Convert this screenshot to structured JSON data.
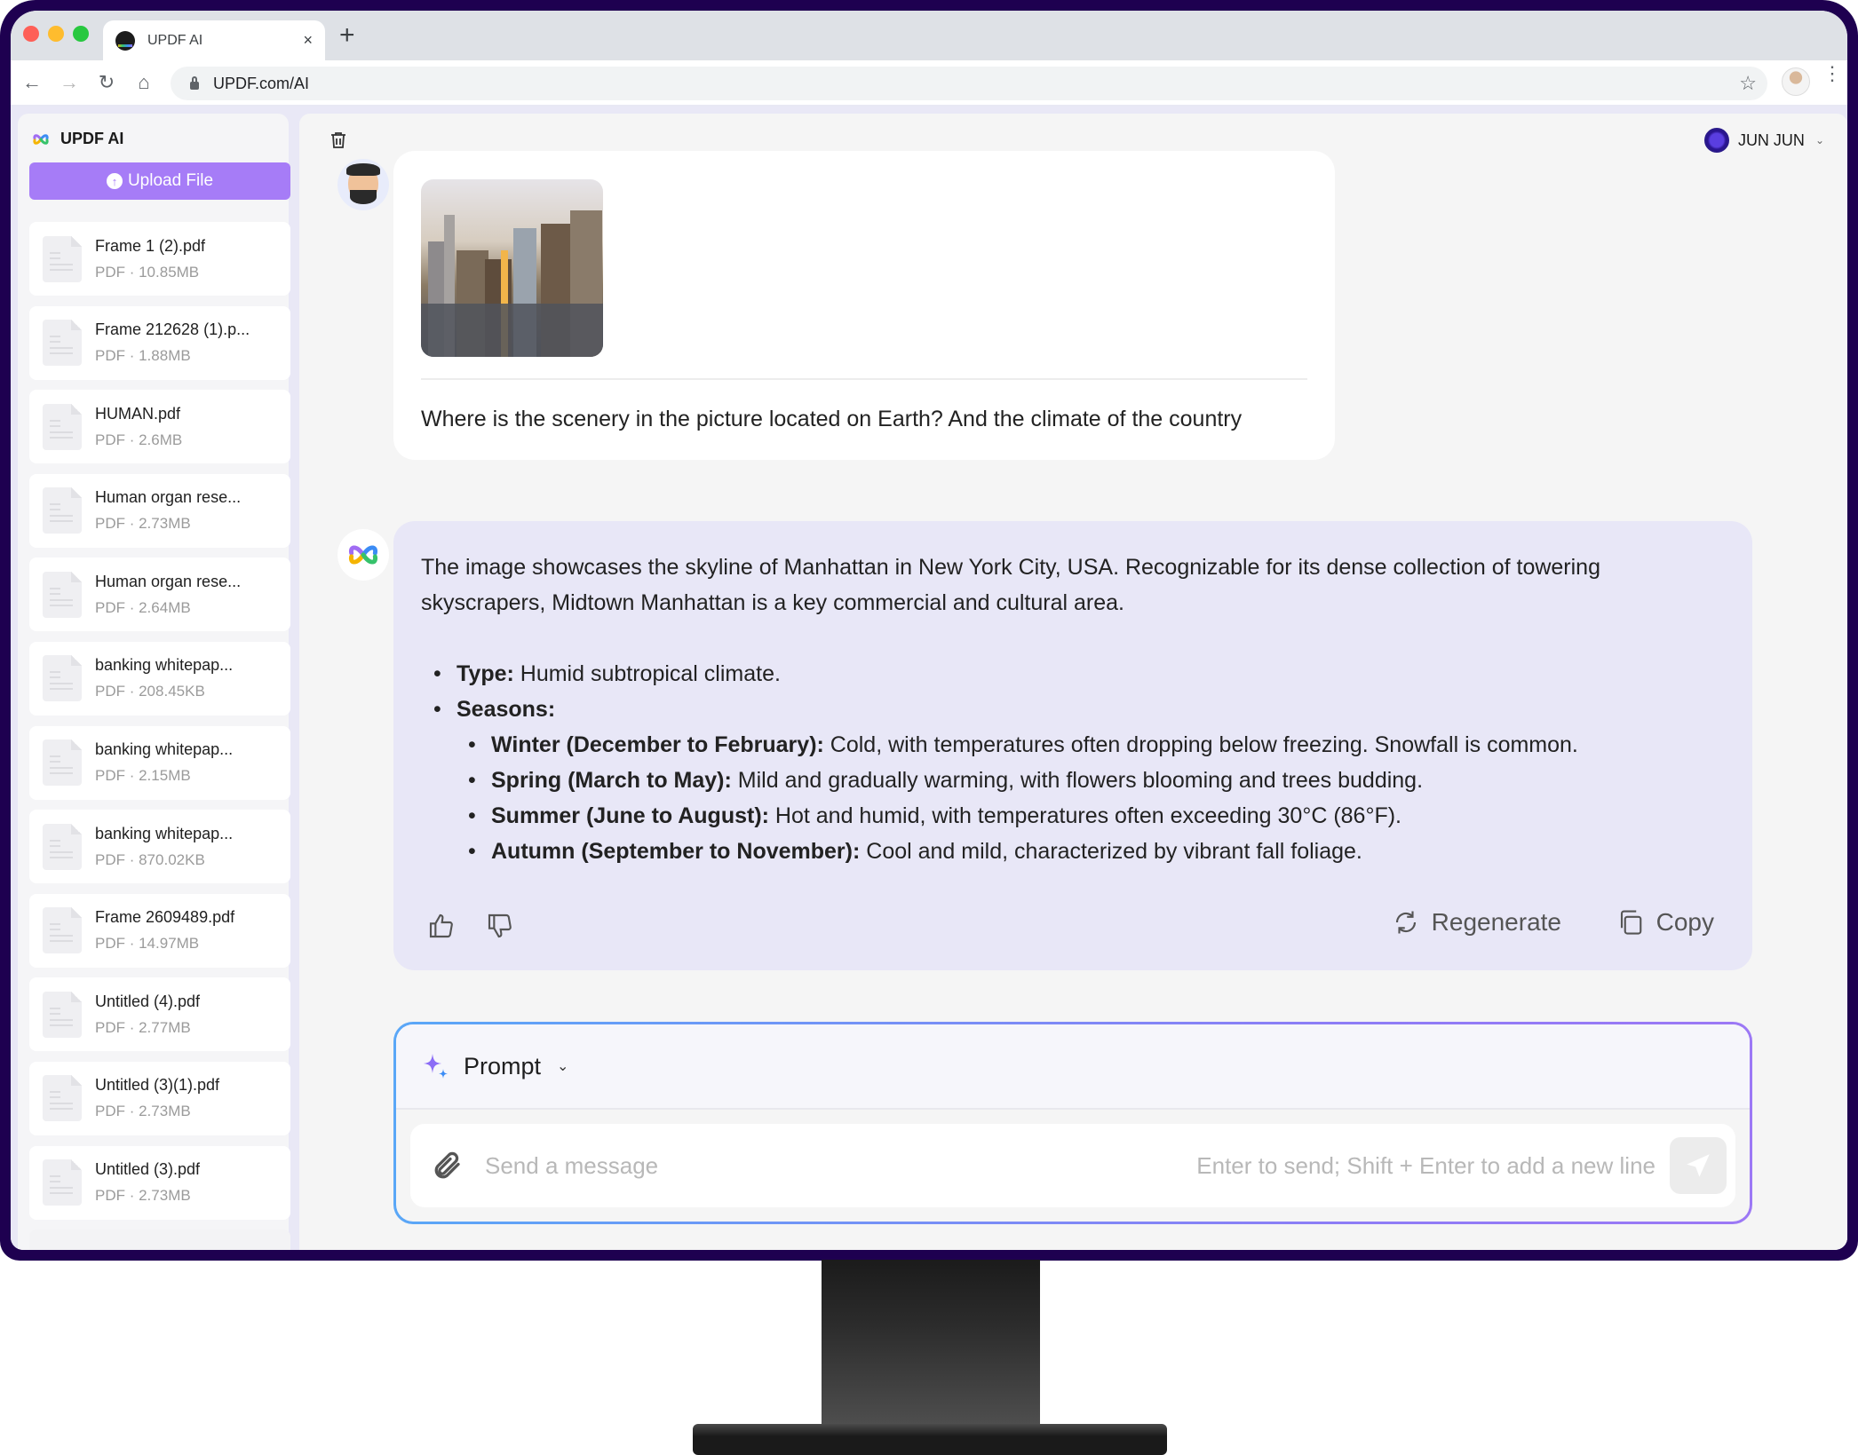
{
  "browser": {
    "tab_title": "UPDF AI",
    "tab_close_icon": "×",
    "new_tab_icon": "+",
    "url": "UPDF.com/AI",
    "back_icon": "←",
    "forward_icon": "→",
    "reload_icon": "↻",
    "home_icon": "⌂",
    "bookmark_icon": "☆",
    "menu_icon": "⋮"
  },
  "sidebar": {
    "brand": "UPDF AI",
    "upload_label": "Upload File",
    "upload_icon": "↑",
    "files": [
      {
        "name": "Frame 1 (2).pdf",
        "meta": "PDF · 10.85MB"
      },
      {
        "name": "Frame 212628 (1).p...",
        "meta": "PDF · 1.88MB"
      },
      {
        "name": "HUMAN.pdf",
        "meta": "PDF · 2.6MB"
      },
      {
        "name": "Human organ rese...",
        "meta": "PDF · 2.73MB"
      },
      {
        "name": "Human organ rese...",
        "meta": "PDF · 2.64MB"
      },
      {
        "name": "banking whitepap...",
        "meta": "PDF · 208.45KB"
      },
      {
        "name": "banking whitepap...",
        "meta": "PDF · 2.15MB"
      },
      {
        "name": "banking whitepap...",
        "meta": "PDF · 870.02KB"
      },
      {
        "name": "Frame 2609489.pdf",
        "meta": "PDF · 14.97MB"
      },
      {
        "name": "Untitled (4).pdf",
        "meta": "PDF · 2.77MB"
      },
      {
        "name": "Untitled (3)(1).pdf",
        "meta": "PDF · 2.73MB"
      },
      {
        "name": "Untitled (3).pdf",
        "meta": "PDF · 2.73MB"
      }
    ]
  },
  "header": {
    "user_name": "JUN JUN",
    "user_chevron": "⌄"
  },
  "chat": {
    "user_message": {
      "text": "Where is the scenery in the picture located on Earth? And the climate of the country",
      "image_alt": "Manhattan skyline at sunset"
    },
    "ai_message": {
      "paragraph": "The image showcases the skyline of Manhattan in New York City, USA. Recognizable for its dense collection of towering skyscrapers, Midtown Manhattan is a key commercial and cultural area.",
      "type_label": "Type:",
      "type_text": " Humid subtropical climate.",
      "seasons_label": "Seasons:",
      "seasons": [
        {
          "label": "Winter (December to February):",
          "text": " Cold, with temperatures often dropping below freezing. Snowfall is common."
        },
        {
          "label": "Spring (March to May):",
          "text": " Mild and gradually warming, with flowers blooming and trees budding."
        },
        {
          "label": "Summer (June to August):",
          "text": " Hot and humid, with temperatures often exceeding 30°C (86°F)."
        },
        {
          "label": "Autumn (September to November):",
          "text": " Cool and mild, characterized by vibrant fall foliage."
        }
      ],
      "regenerate_label": "Regenerate",
      "copy_label": "Copy"
    }
  },
  "composer": {
    "prompt_label": "Prompt",
    "prompt_chevron": "⌄",
    "placeholder": "Send a message",
    "hint": "Enter to send; Shift + Enter to add a new line"
  },
  "colors": {
    "bezel": "#1e0050",
    "accent": "#a67cf7",
    "ai_bubble": "#e8e7f7",
    "composer_border_start": "#5aa7f7",
    "composer_border_end": "#9c78f5"
  }
}
